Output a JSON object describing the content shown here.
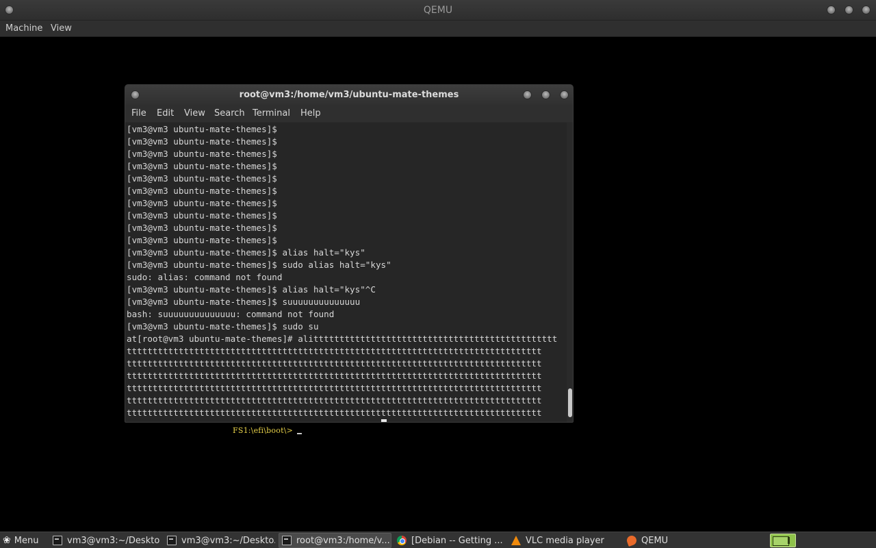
{
  "qemu": {
    "title": "QEMU",
    "menu": [
      "Machine",
      "View"
    ]
  },
  "guest": {
    "efi_prompt": "FS1:\\efi\\boot\\>"
  },
  "terminal": {
    "title": "root@vm3:/home/vm3/ubuntu-mate-themes",
    "menu": [
      "File",
      "Edit",
      "View",
      "Search",
      "Terminal",
      "Help"
    ],
    "lines": [
      "[vm3@vm3 ubuntu-mate-themes]$",
      "[vm3@vm3 ubuntu-mate-themes]$",
      "[vm3@vm3 ubuntu-mate-themes]$",
      "[vm3@vm3 ubuntu-mate-themes]$",
      "[vm3@vm3 ubuntu-mate-themes]$",
      "[vm3@vm3 ubuntu-mate-themes]$",
      "[vm3@vm3 ubuntu-mate-themes]$",
      "[vm3@vm3 ubuntu-mate-themes]$",
      "[vm3@vm3 ubuntu-mate-themes]$",
      "[vm3@vm3 ubuntu-mate-themes]$",
      "[vm3@vm3 ubuntu-mate-themes]$ alias halt=\"kys\"",
      "[vm3@vm3 ubuntu-mate-themes]$ sudo alias halt=\"kys\"",
      "sudo: alias: command not found",
      "[vm3@vm3 ubuntu-mate-themes]$ alias halt=\"kys\"^C",
      "[vm3@vm3 ubuntu-mate-themes]$ suuuuuuuuuuuuuu",
      "bash: suuuuuuuuuuuuuu: command not found",
      "[vm3@vm3 ubuntu-mate-themes]$ sudo su",
      "at[root@vm3 ubuntu-mate-themes]# alittttttttttttttttttttttttttttttttttttttttttttttt",
      "tttttttttttttttttttttttttttttttttttttttttttttttttttttttttttttttttttttttttttttttt",
      "tttttttttttttttttttttttttttttttttttttttttttttttttttttttttttttttttttttttttttttttt",
      "tttttttttttttttttttttttttttttttttttttttttttttttttttttttttttttttttttttttttttttttt",
      "tttttttttttttttttttttttttttttttttttttttttttttttttttttttttttttttttttttttttttttttt",
      "tttttttttttttttttttttttttttttttttttttttttttttttttttttttttttttttttttttttttttttttt",
      "tttttttttttttttttttttttttttttttttttttttttttttttttttttttttttttttttttttttttttttttt"
    ],
    "last_line": "ttttttttttttttttttttttttttttttttttttttttttttttttt"
  },
  "taskbar": {
    "menu_label": "Menu",
    "tasks": [
      {
        "label": "vm3@vm3:~/Desktop",
        "icon": "terminal-icon"
      },
      {
        "label": "vm3@vm3:~/Deskto...",
        "icon": "terminal-icon"
      },
      {
        "label": "root@vm3:/home/v...",
        "icon": "terminal-icon"
      },
      {
        "label": "[Debian -- Getting ...",
        "icon": "chrome-icon"
      },
      {
        "label": "VLC media player",
        "icon": "vlc-icon"
      },
      {
        "label": "QEMU",
        "icon": "qemu-icon"
      }
    ]
  }
}
